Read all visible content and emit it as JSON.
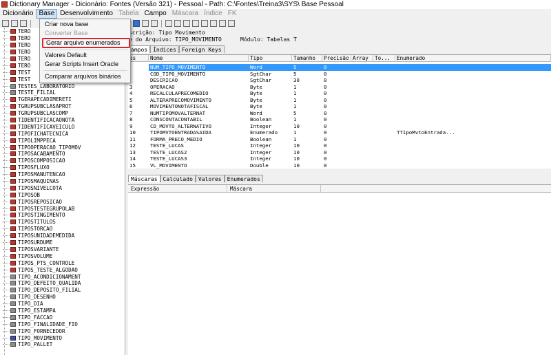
{
  "window": {
    "title": "Dictionary Manager - Dicionário: Fontes (Versão 321) - Pessoal - Path: C:\\Fontes\\Treina3\\SYS\\ Base Pessoal"
  },
  "menubar": [
    {
      "label": "Dicionário",
      "state": "normal"
    },
    {
      "label": "Base",
      "state": "active"
    },
    {
      "label": "Desenvolvimento",
      "state": "normal"
    },
    {
      "label": "Tabela",
      "state": "disabled"
    },
    {
      "label": "Campo",
      "state": "normal"
    },
    {
      "label": "Máscara",
      "state": "disabled"
    },
    {
      "label": "Índice",
      "state": "disabled"
    },
    {
      "label": "FK",
      "state": "disabled"
    }
  ],
  "base_menu": {
    "items": [
      {
        "label": "Criar nova base",
        "disabled": false
      },
      {
        "label": "Converter Base",
        "disabled": true
      },
      {
        "label": "Gerar arquivo enumerados",
        "disabled": false,
        "highlighted": true
      },
      {
        "label": "Valores Default",
        "disabled": false
      },
      {
        "label": "Gerar Scripts Insert Oracle",
        "disabled": false
      },
      {
        "label": "Comparar arquivos binários",
        "disabled": false
      }
    ]
  },
  "tree": {
    "items": [
      "TERO",
      "TERO",
      "TERO",
      "TERO",
      "TERO",
      "TERO",
      "TEST",
      "TEST",
      "TESTES_LABORATORIO",
      "TESTE_FILIAL",
      "TGERAPECADIMERETI",
      "TGRUPSUBCLASAPROT",
      "TGRUPSUBCLASCOMP",
      "TIDENTIFICACAONOTA",
      "TIDENTIFICAVEICULO",
      "TIPOFICHATECNICA",
      "TIPOLIMPPECA",
      "TIPOOPERACAO_TIPOMOV",
      "TIPOSACABAMENTO",
      "TIPOSCOMPOSICAO",
      "TIPOSFLUXO",
      "TIPOSMANUTENCAO",
      "TIPOSMAQUINAS",
      "TIPOSNIVELCOTA",
      "TIPOSOB",
      "TIPOSREPOSICAO",
      "TIPOSTESTEGRUPOLAB",
      "TIPOSTINGIMENTO",
      "TIPOSTITULOS",
      "TIPOSTORCAO",
      "TIPOSUNIDADEMEDIDA",
      "TIPOSURDUME",
      "TIPOSVARIANTE",
      "TIPOSVOLUME",
      "TIPOS_PTS_CONTROLE",
      "TIPOS_TESTE_ALGODAO",
      "TIPO_ACONDICIONAMENT",
      "TIPO_DEFEITO_QUALIDA",
      "TIPO_DEPOSITO_FILIAL",
      "TIPO_DESENHO",
      "TIPO_DIA",
      "TIPO_ESTAMPA",
      "TIPO_FACCAO",
      "TIPO_FINALIDADE_FIO",
      "TIPO_FORNECEDOR",
      "TIPO_MOVIMENTO",
      "TIPO_PALLET"
    ]
  },
  "info": {
    "description_label": "scrição: Tipo Movimento",
    "file_label": "e do Arquivo: TIPO_MOVIMENTO",
    "module_label": "Módulo: Tabelas T"
  },
  "top_tabs": [
    "ampos",
    "Índices",
    "Foreign Keys"
  ],
  "grid": {
    "headers": [
      "os",
      "Nome",
      "Tipo",
      "Tamanho",
      "Precisão",
      "Array",
      "To...",
      "Enumerado"
    ],
    "rows": [
      {
        "pos": "",
        "nome": "NUM_TIPO_MOVIMENTO",
        "tipo": "Word",
        "tamanho": "5",
        "precisao": "0",
        "enumerado": ""
      },
      {
        "pos": "",
        "nome": "COD_TIPO_MOVIMENTO",
        "tipo": "SgtChar",
        "tamanho": "5",
        "precisao": "0",
        "enumerado": ""
      },
      {
        "pos": "",
        "nome": "DESCRICAO",
        "tipo": "SgtChar",
        "tamanho": "30",
        "precisao": "0",
        "enumerado": ""
      },
      {
        "pos": "3",
        "nome": "OPERACAO",
        "tipo": "Byte",
        "tamanho": "1",
        "precisao": "0",
        "enumerado": ""
      },
      {
        "pos": "4",
        "nome": "RECALCULAPRECOMEDIO",
        "tipo": "Byte",
        "tamanho": "1",
        "precisao": "0",
        "enumerado": ""
      },
      {
        "pos": "5",
        "nome": "ALTERAPRECOMOVIMENTO",
        "tipo": "Byte",
        "tamanho": "1",
        "precisao": "0",
        "enumerado": ""
      },
      {
        "pos": "6",
        "nome": "MOVIMENTONOTAFISCAL",
        "tipo": "Byte",
        "tamanho": "1",
        "precisao": "0",
        "enumerado": ""
      },
      {
        "pos": "7",
        "nome": "NUMTIPOMOVALTERNAT",
        "tipo": "Word",
        "tamanho": "5",
        "precisao": "0",
        "enumerado": ""
      },
      {
        "pos": "8",
        "nome": "CONSCONTACONTABIL",
        "tipo": "Boolean",
        "tamanho": "1",
        "precisao": "0",
        "enumerado": ""
      },
      {
        "pos": "9",
        "nome": "CD_MOVTO_ALTERNATIVO",
        "tipo": "Integer",
        "tamanho": "10",
        "precisao": "0",
        "enumerado": ""
      },
      {
        "pos": "10",
        "nome": "TIPOMVTOENTRADASAIDA",
        "tipo": "Enumerado",
        "tamanho": "1",
        "precisao": "0",
        "enumerado": "TTipoMvtoEntrada..."
      },
      {
        "pos": "11",
        "nome": "FORMA_PRECO_MEDIO",
        "tipo": "Boolean",
        "tamanho": "1",
        "precisao": "0",
        "enumerado": ""
      },
      {
        "pos": "12",
        "nome": "TESTE_LUCAS",
        "tipo": "Integer",
        "tamanho": "10",
        "precisao": "0",
        "enumerado": ""
      },
      {
        "pos": "13",
        "nome": "TESTE_LUCAS2",
        "tipo": "Integer",
        "tamanho": "10",
        "precisao": "0",
        "enumerado": ""
      },
      {
        "pos": "14",
        "nome": "TESTE_LUCAS3",
        "tipo": "Integer",
        "tamanho": "10",
        "precisao": "0",
        "enumerado": ""
      },
      {
        "pos": "15",
        "nome": "VL_MOVIMENTO",
        "tipo": "Double",
        "tamanho": "10",
        "precisao": "0",
        "enumerado": ""
      }
    ]
  },
  "bottom_tabs": [
    "Máscaras",
    "Calculado",
    "Valores",
    "Enumerados"
  ],
  "bottom_grid": {
    "headers": [
      "Expressão",
      "Máscara"
    ]
  },
  "icons": {
    "table": "table-icon",
    "special": "view-icon"
  }
}
